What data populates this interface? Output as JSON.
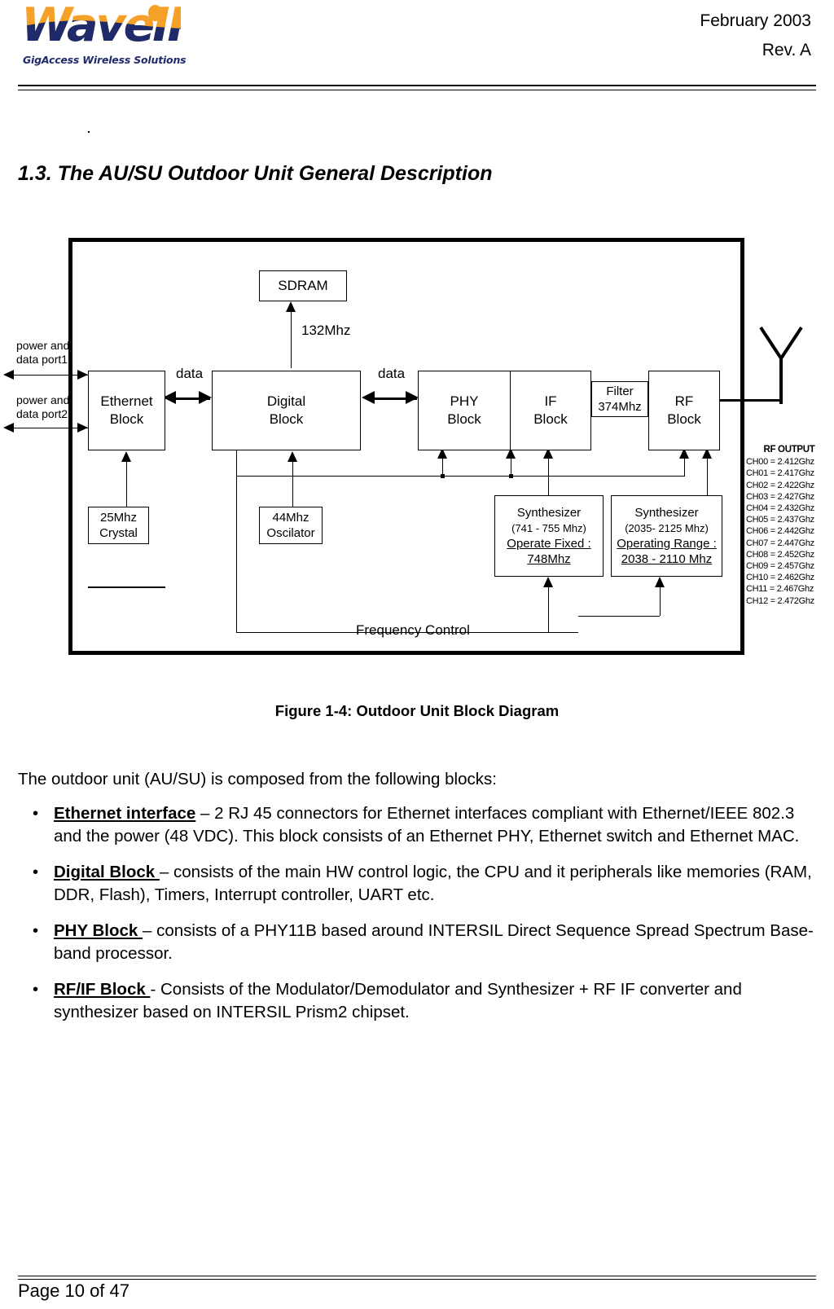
{
  "header": {
    "logo_wordmark": "WaveIP",
    "logo_tagline": "GigAccess Wireless Solutions",
    "date": "February 2003",
    "revision": "Rev. A"
  },
  "section": {
    "title": "1.3. The AU/SU Outdoor Unit General Description"
  },
  "diagram": {
    "blocks": {
      "sdram": "SDRAM",
      "ethernet_line1": "Ethernet",
      "ethernet_line2": "Block",
      "digital_line1": "Digital",
      "digital_line2": "Block",
      "phy_line1": "PHY",
      "phy_line2": "Block",
      "if_line1": "IF",
      "if_line2": "Block",
      "filter_line1": "Filter",
      "filter_line2": "374Mhz",
      "rf_line1": "RF",
      "rf_line2": "Block",
      "crystal_line1": "25Mhz",
      "crystal_line2": "Crystal",
      "oscillator_line1": "44Mhz",
      "oscillator_line2": "Oscilator",
      "synth1_line1": "Synthesizer",
      "synth1_line2": "(741 - 755 Mhz)",
      "synth1_line3": "Operate Fixed :",
      "synth1_line4": "748Mhz",
      "synth2_line1": "Synthesizer",
      "synth2_line2": "(2035- 2125 Mhz)",
      "synth2_line3": "Operating Range :",
      "synth2_line4": "2038 - 2110 Mhz"
    },
    "labels": {
      "port1_line1": "power and",
      "port1_line2": "data port1",
      "port2_line1": "power and",
      "port2_line2": "data port2",
      "data_eth_digital": "data",
      "data_digital_phy": "data",
      "sdram_clock": "132Mhz",
      "frequency_control": "Frequency Control"
    },
    "rf_output": {
      "title": "RF OUTPUT",
      "channels": [
        "CH00 = 2.412Ghz",
        "CH01 = 2.417Ghz",
        "CH02 = 2.422Ghz",
        "CH03 = 2.427Ghz",
        "CH04 = 2.432Ghz",
        "CH05 = 2.437Ghz",
        "CH06 = 2.442Ghz",
        "CH07 = 2.447Ghz",
        "CH08 = 2.452Ghz",
        "CH09 = 2.457Ghz",
        "CH10 = 2.462Ghz",
        "CH11 = 2.467Ghz",
        "CH12 = 2.472Ghz"
      ]
    }
  },
  "figure": {
    "caption": "Figure 1-4: Outdoor Unit Block Diagram"
  },
  "body": {
    "intro": "The outdoor unit (AU/SU) is composed from the following blocks:",
    "bullet_char": "•",
    "items": [
      {
        "term": "Ethernet interface",
        "text": " – 2 RJ 45 connectors for Ethernet interfaces compliant with Ethernet/IEEE 802.3 and the power (48 VDC). This block consists of an Ethernet PHY, Ethernet switch and Ethernet MAC."
      },
      {
        "term": "Digital Block ",
        "text": "– consists of the main HW control logic, the CPU and it peripherals like memories (RAM, DDR, Flash), Timers, Interrupt controller, UART etc."
      },
      {
        "term": "PHY Block ",
        "text": "– consists of a PHY11B based around INTERSIL Direct Sequence Spread Spectrum Base-band processor."
      },
      {
        "term": "RF/IF Block ",
        "text": "- Consists of the Modulator/Demodulator and Synthesizer + RF IF converter and synthesizer based on INTERSIL Prism2 chipset."
      }
    ]
  },
  "footer": {
    "page": "Page 10 of 47"
  }
}
